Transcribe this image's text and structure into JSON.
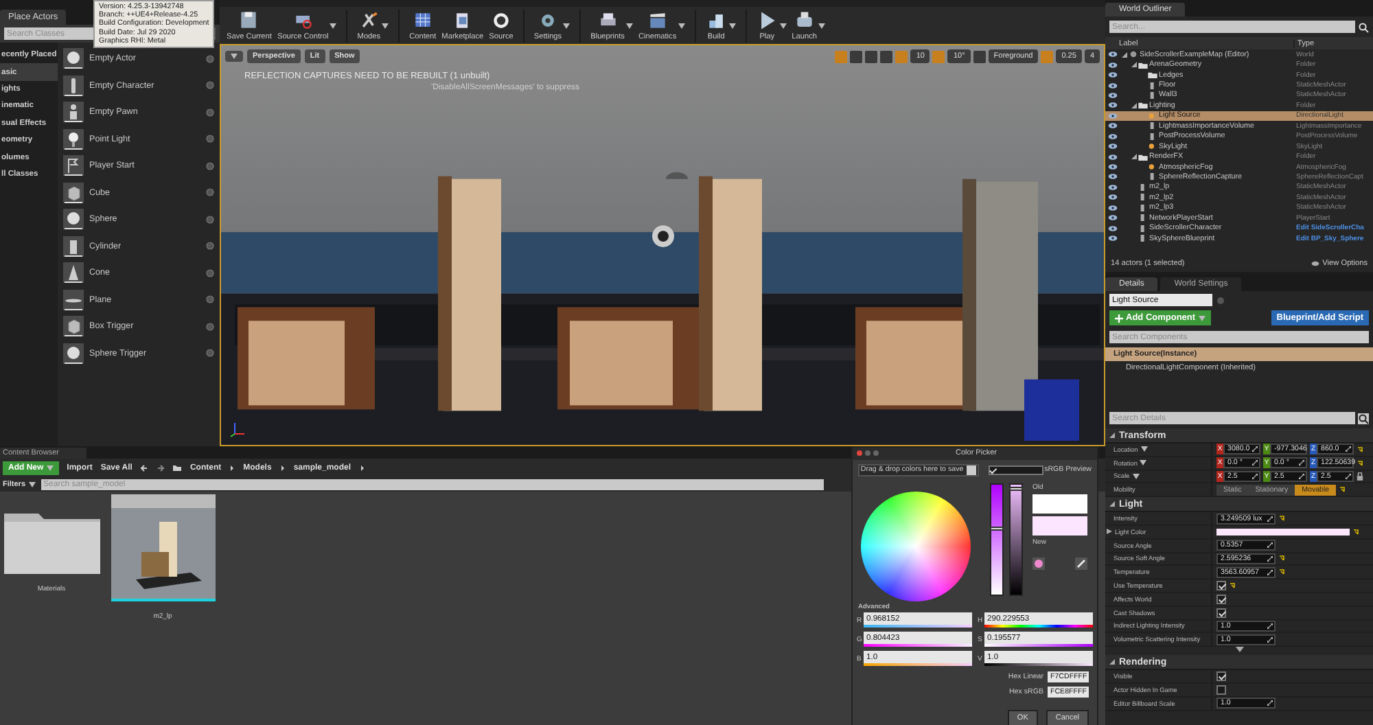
{
  "tooltip": {
    "lines": [
      "Version: 4.25.3-13942748",
      "Branch: ++UE4+Release-4.25",
      "Build Configuration: Development",
      "Build Date: Jul 29 2020",
      "Graphics RHI: Metal"
    ]
  },
  "place_actors": {
    "tab": "Place Actors",
    "search": {
      "placeholder": "Search Classes"
    },
    "categories": [
      {
        "label": "ecently Placed",
        "selected": false
      },
      {
        "label": "asic",
        "selected": true
      },
      {
        "label": "ights",
        "selected": false
      },
      {
        "label": "inematic",
        "selected": false
      },
      {
        "label": "sual Effects",
        "selected": false
      },
      {
        "label": "eometry",
        "selected": false
      },
      {
        "label": "olumes",
        "selected": false
      },
      {
        "label": "ll Classes",
        "selected": false
      }
    ],
    "items": [
      "Empty Actor",
      "Empty Character",
      "Empty Pawn",
      "Point Light",
      "Player Start",
      "Cube",
      "Sphere",
      "Cylinder",
      "Cone",
      "Plane",
      "Box Trigger",
      "Sphere Trigger"
    ]
  },
  "toolbar": {
    "buttons": [
      {
        "label": "Save Current",
        "dropdown": false
      },
      {
        "label": "Source Control",
        "dropdown": true
      },
      {
        "label": "Modes",
        "dropdown": true
      },
      {
        "label": "Content",
        "dropdown": false
      },
      {
        "label": "Marketplace",
        "dropdown": false
      },
      {
        "label": "Source",
        "dropdown": false
      },
      {
        "label": "Settings",
        "dropdown": true
      },
      {
        "label": "Blueprints",
        "dropdown": true
      },
      {
        "label": "Cinematics",
        "dropdown": true
      },
      {
        "label": "Build",
        "dropdown": true
      },
      {
        "label": "Play",
        "dropdown": true
      },
      {
        "label": "Launch",
        "dropdown": true
      }
    ]
  },
  "viewport": {
    "view_buttons": [
      "Perspective",
      "Lit",
      "Show"
    ],
    "message": "REFLECTION CAPTURES NEED TO BE REBUILT (1 unbuilt)",
    "hint": "'DisableAllScreenMessages' to suppress",
    "grid_snap": "10",
    "rotation_snap": "10°",
    "layer": "Foreground",
    "scale_snap": "0.25",
    "camera_speed": "4"
  },
  "world_outliner": {
    "tab": "World Outliner",
    "search": {
      "placeholder": "Search..."
    },
    "columns": [
      "Label",
      "Type"
    ],
    "rows": [
      {
        "kind": "world",
        "label": "SideScrollerExampleMap (Editor)",
        "type": "World",
        "selected": false,
        "children": [
          {
            "kind": "folder",
            "label": "ArenaGeometry",
            "type": "Folder",
            "selected": false,
            "children": [
              {
                "kind": "folder",
                "label": "Ledges",
                "type": "Folder",
                "selected": false
              },
              {
                "kind": "actor",
                "label": "Floor",
                "type": "StaticMeshActor",
                "selected": false
              },
              {
                "kind": "actor",
                "label": "Wall3",
                "type": "StaticMeshActor",
                "selected": false
              }
            ]
          },
          {
            "kind": "folder",
            "label": "Lighting",
            "type": "Folder",
            "selected": false,
            "children": [
              {
                "kind": "light",
                "label": "Light Source",
                "type": "DirectionalLight",
                "selected": true
              },
              {
                "kind": "actor",
                "label": "LightmassImportanceVolume",
                "type": "LightmassImportance",
                "selected": false
              },
              {
                "kind": "actor",
                "label": "PostProcessVolume",
                "type": "PostProcessVolume",
                "selected": false
              },
              {
                "kind": "light",
                "label": "SkyLight",
                "type": "SkyLight",
                "selected": false
              }
            ]
          },
          {
            "kind": "folder",
            "label": "RenderFX",
            "type": "Folder",
            "selected": false,
            "children": [
              {
                "kind": "light",
                "label": "AtmosphericFog",
                "type": "AtmosphericFog",
                "selected": false
              },
              {
                "kind": "actor",
                "label": "SphereReflectionCapture",
                "type": "SphereReflectionCapt",
                "selected": false
              }
            ]
          },
          {
            "kind": "actor",
            "label": "m2_lp",
            "type": "StaticMeshActor",
            "selected": false
          },
          {
            "kind": "actor",
            "label": "m2_lp2",
            "type": "StaticMeshActor",
            "selected": false
          },
          {
            "kind": "actor",
            "label": "m2_lp3",
            "type": "StaticMeshActor",
            "selected": false
          },
          {
            "kind": "actor",
            "label": "NetworkPlayerStart",
            "type": "PlayerStart",
            "selected": false
          },
          {
            "kind": "actor",
            "label": "SideScrollerCharacter",
            "edit_link": "Edit SideScrollerCha",
            "selected": false
          },
          {
            "kind": "actor",
            "label": "SkySphereBlueprint",
            "edit_link": "Edit BP_Sky_Sphere",
            "selected": false
          }
        ]
      }
    ],
    "footer": "14 actors (1 selected)",
    "view_options": "View Options"
  },
  "details": {
    "tabs": [
      {
        "label": "Details",
        "selected": true
      },
      {
        "label": "World Settings",
        "selected": false
      }
    ],
    "name": "Light Source",
    "add_component": "Add Component",
    "blueprint": "Blueprint/Add Script",
    "search_components": {
      "placeholder": "Search Components"
    },
    "components": [
      {
        "label": "Light Source(Instance)",
        "selected": true
      },
      {
        "label": "DirectionalLightComponent (Inherited)",
        "selected": false
      }
    ],
    "search_details": {
      "placeholder": "Search Details"
    },
    "sections": [
      {
        "title": "Transform",
        "rows": [
          {
            "kind": "vector",
            "label": "Location",
            "modified": true,
            "locked": false,
            "values": [
              {
                "axis": "X",
                "value": "3080.0"
              },
              {
                "axis": "Y",
                "value": "-977.3046"
              },
              {
                "axis": "Z",
                "value": "860.0"
              }
            ]
          },
          {
            "kind": "vector",
            "label": "Rotation",
            "modified": true,
            "locked": false,
            "values": [
              {
                "axis": "X",
                "value": "0.0 °"
              },
              {
                "axis": "Y",
                "value": "0.0 °"
              },
              {
                "axis": "Z",
                "value": "122.50639"
              }
            ]
          },
          {
            "kind": "vector",
            "label": "Scale",
            "modified": false,
            "locked": true,
            "values": [
              {
                "axis": "X",
                "value": "2.5"
              },
              {
                "axis": "Y",
                "value": "2.5"
              },
              {
                "axis": "Z",
                "value": "2.5"
              }
            ]
          },
          {
            "kind": "mobility",
            "label": "Mobility",
            "modified": true,
            "options": [
              {
                "label": "Static",
                "selected": false
              },
              {
                "label": "Stationary",
                "selected": false
              },
              {
                "label": "Movable",
                "selected": true
              }
            ]
          }
        ]
      },
      {
        "title": "Light",
        "rows": [
          {
            "kind": "number",
            "label": "Intensity",
            "value": "3.249509 lux",
            "modified": true
          },
          {
            "kind": "color",
            "label": "Light Color",
            "modified": true
          },
          {
            "kind": "number",
            "label": "Source Angle",
            "value": "0.5357",
            "modified": false
          },
          {
            "kind": "number",
            "label": "Source Soft Angle",
            "value": "2.595236",
            "modified": true
          },
          {
            "kind": "number",
            "label": "Temperature",
            "value": "3563.60957",
            "modified": true
          },
          {
            "kind": "checkbox",
            "label": "Use Temperature",
            "checked": true,
            "modified": true
          },
          {
            "kind": "checkbox",
            "label": "Affects World",
            "checked": true,
            "modified": false
          },
          {
            "kind": "checkbox",
            "label": "Cast Shadows",
            "checked": true,
            "modified": false
          },
          {
            "kind": "number",
            "label": "Indirect Lighting Intensity",
            "value": "1.0",
            "modified": false
          },
          {
            "kind": "number",
            "label": "Volumetric Scattering Intensity",
            "value": "1.0",
            "modified": false
          }
        ]
      },
      {
        "title": "Rendering",
        "rows": [
          {
            "kind": "checkbox",
            "label": "Visible",
            "checked": true,
            "modified": false
          },
          {
            "kind": "checkbox",
            "label": "Actor Hidden In Game",
            "checked": false,
            "modified": false
          },
          {
            "kind": "number",
            "label": "Editor Billboard Scale",
            "value": "1.0",
            "modified": false
          }
        ]
      }
    ]
  },
  "content_browser": {
    "tab": "Content Browser",
    "add_new": "Add New",
    "import": "Import",
    "save_all": "Save All",
    "path": [
      "Content",
      "Models",
      "sample_model"
    ],
    "filters": "Filters",
    "search": {
      "placeholder": "Search sample_model"
    },
    "assets": [
      {
        "kind": "folder",
        "label": "Materials"
      },
      {
        "kind": "mesh",
        "label": "m2_lp"
      }
    ]
  },
  "color_picker": {
    "title": "Color Picker",
    "swatch_hint": "Drag & drop colors here to save",
    "srgb_preview": {
      "label": "sRGB Preview",
      "checked": true
    },
    "saturation_slider": {
      "level": 0.6
    },
    "value_slider": {
      "level": 1.0
    },
    "old_label": "Old",
    "new_label": "New",
    "advanced": "Advanced",
    "rgb": [
      {
        "label": "R",
        "value": "0.968152"
      },
      {
        "label": "G",
        "value": "0.804423"
      },
      {
        "label": "B",
        "value": "1.0"
      }
    ],
    "hsv": [
      {
        "label": "H",
        "value": "290.229553"
      },
      {
        "label": "S",
        "value": "0.195577"
      },
      {
        "label": "V",
        "value": "1.0"
      }
    ],
    "hex": [
      {
        "label": "Hex Linear",
        "value": "F7CDFFFF"
      },
      {
        "label": "Hex sRGB",
        "value": "FCE8FFFF"
      }
    ],
    "buttons": [
      "OK",
      "Cancel"
    ]
  }
}
